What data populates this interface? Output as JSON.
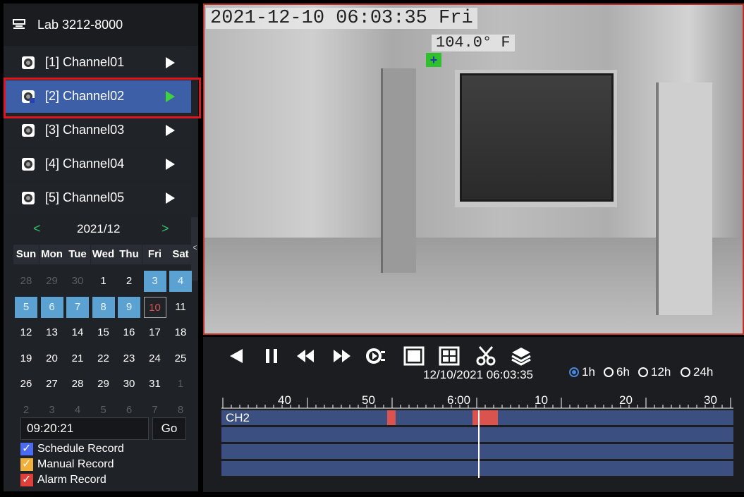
{
  "device": {
    "name": "Lab 3212-8000",
    "icon": "device-icon"
  },
  "channels": [
    {
      "label": "[1] Channel01",
      "selected": false
    },
    {
      "label": "[2] Channel02",
      "selected": true
    },
    {
      "label": "[3] Channel03",
      "selected": false
    },
    {
      "label": "[4] Channel04",
      "selected": false
    },
    {
      "label": "[5] Channel05",
      "selected": false
    }
  ],
  "calendar": {
    "month": "2021/12",
    "prev": "<",
    "next": ">",
    "collapse": "<",
    "weekdays": [
      "Sun",
      "Mon",
      "Tue",
      "Wed",
      "Thu",
      "Fri",
      "Sat"
    ],
    "days": [
      [
        "28",
        "29",
        "30",
        "1",
        "2",
        "3",
        "4"
      ],
      [
        "5",
        "6",
        "7",
        "8",
        "9",
        "10",
        "11"
      ],
      [
        "12",
        "13",
        "14",
        "15",
        "16",
        "17",
        "18"
      ],
      [
        "19",
        "20",
        "21",
        "22",
        "23",
        "24",
        "25"
      ],
      [
        "26",
        "27",
        "28",
        "29",
        "30",
        "31",
        "1"
      ],
      [
        "2",
        "3",
        "4",
        "5",
        "6",
        "7",
        "8"
      ]
    ],
    "recorded_days": [
      "3",
      "4",
      "5",
      "6",
      "7",
      "8",
      "9"
    ],
    "today": "10"
  },
  "time_jump": {
    "value": "09:20:21",
    "go_label": "Go"
  },
  "legend": [
    {
      "label": "Schedule Record",
      "color": "#4a6cf0"
    },
    {
      "label": "Manual Record",
      "color": "#f0b03a"
    },
    {
      "label": "Alarm Record",
      "color": "#e0403a"
    }
  ],
  "video": {
    "osd_timestamp": "2021-12-10 06:03:35 Fri",
    "temperature": "104.0° F",
    "target_marker": "+"
  },
  "playback": {
    "timestamp": "12/10/2021 06:03:35",
    "ranges": [
      {
        "label": "1h",
        "selected": true
      },
      {
        "label": "6h",
        "selected": false
      },
      {
        "label": "12h",
        "selected": false
      },
      {
        "label": "24h",
        "selected": false
      }
    ],
    "ruler_labels": [
      "40",
      "50",
      "6:00",
      "10",
      "20",
      "30"
    ],
    "tracks": [
      "CH2",
      "",
      "",
      ""
    ]
  }
}
